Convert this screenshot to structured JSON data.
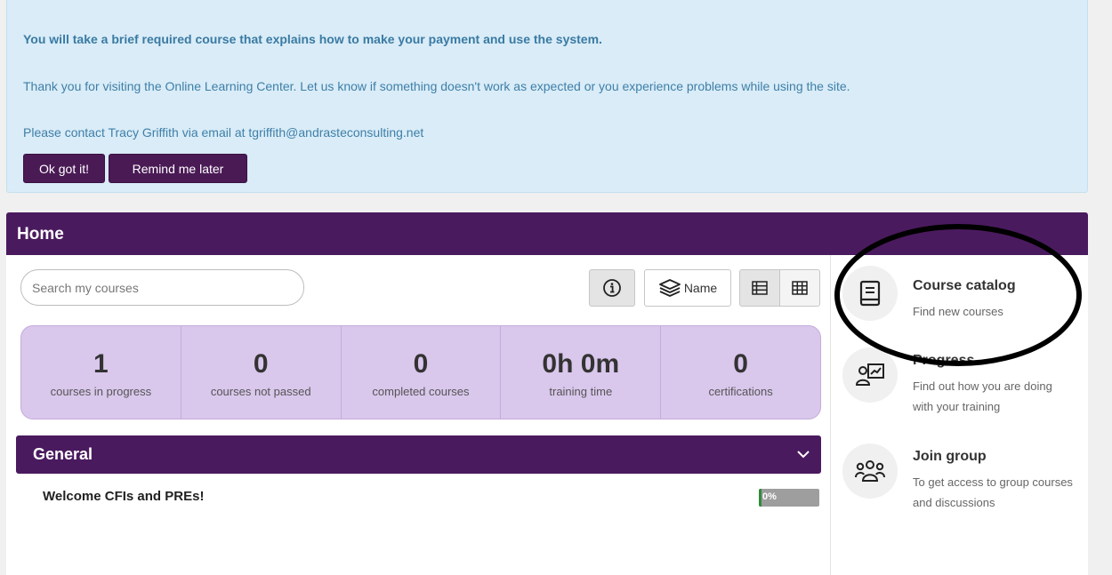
{
  "notice": {
    "line1": "You will take a brief required course that explains how to make your payment and use the system.",
    "line2": "Thank you for visiting the Online Learning Center. Let us know if something doesn't work as expected or you experience problems while using the site.",
    "line3": "Please contact Tracy Griffith via email at tgriffith@andrasteconsulting.net",
    "ok_label": "Ok got it!",
    "remind_label": "Remind me later"
  },
  "home": {
    "title": "Home",
    "search_placeholder": "Search my courses",
    "sort_label": "Name"
  },
  "stats": [
    {
      "value": "1",
      "label": "courses in progress"
    },
    {
      "value": "0",
      "label": "courses not passed"
    },
    {
      "value": "0",
      "label": "completed courses"
    },
    {
      "value": "0h 0m",
      "label": "training time"
    },
    {
      "value": "0",
      "label": "certifications"
    }
  ],
  "general": {
    "title": "General",
    "courses": [
      {
        "title": "Welcome CFIs and PREs!",
        "progress_text": "0%",
        "progress_fraction": 0.0
      }
    ]
  },
  "sidebar": {
    "items": [
      {
        "title": "Course catalog",
        "desc": "Find new courses",
        "icon": "book-icon"
      },
      {
        "title": "Progress",
        "desc": "Find out how you are doing with your training",
        "icon": "progress-chart-icon"
      },
      {
        "title": "Join group",
        "desc": "To get access to group courses and discussions",
        "icon": "group-icon"
      }
    ]
  },
  "colors": {
    "brand_purple": "#4a1a5e",
    "notice_bg": "#d9ecf7",
    "notice_text": "#3f7fa8",
    "stats_bg": "#d9c7ec",
    "progress_green": "#2e8b3a"
  }
}
